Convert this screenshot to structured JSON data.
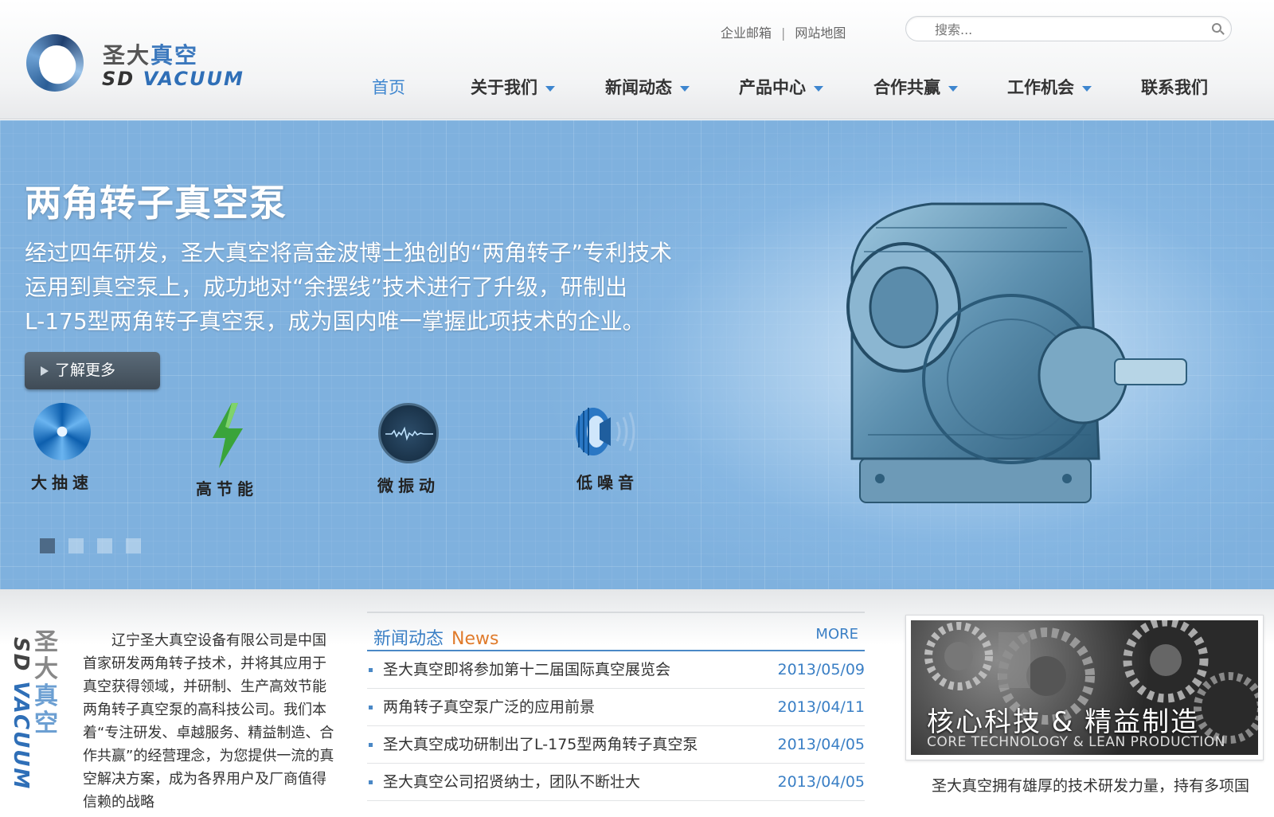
{
  "header": {
    "logo": {
      "cn_plain": "圣大",
      "cn_highlight": "真空",
      "en_plain": "SD",
      "en_highlight": "VACUUM"
    },
    "top_links": [
      "企业邮箱",
      "网站地图"
    ],
    "search": {
      "placeholder": "搜索..."
    },
    "nav": [
      {
        "label": "首页",
        "active": true,
        "dropdown": false
      },
      {
        "label": "关于我们",
        "dropdown": true
      },
      {
        "label": "新闻动态",
        "dropdown": true
      },
      {
        "label": "产品中心",
        "dropdown": true
      },
      {
        "label": "合作共赢",
        "dropdown": true
      },
      {
        "label": "工作机会",
        "dropdown": true
      },
      {
        "label": "联系我们",
        "dropdown": false
      }
    ]
  },
  "banner": {
    "title": "两角转子真空泵",
    "lines": [
      "经过四年研发，圣大真空将高金波博士独创的“两角转子”专利技术",
      "运用到真空泵上，成功地对“余摆线”技术进行了升级，研制出",
      "L-175型两角转子真空泵，成为国内唯一掌握此项技术的企业。"
    ],
    "button": "了解更多",
    "features": [
      "大抽速",
      "高节能",
      "微振动",
      "低噪音"
    ],
    "slide_count": 4,
    "active_slide": 1
  },
  "intro": {
    "text": "辽宁圣大真空设备有限公司是中国首家研发两角转子技术，并将其应用于真空获得领域，并研制、生产高效节能两角转子真空泵的高科技公司。我们本着“专注研发、卓越服务、精益制造、合作共赢”的经营理念，为您提供一流的真空解决方案，成为各界用户及厂商值得信赖的战略"
  },
  "news": {
    "title_cn": "新闻动态",
    "title_en": "News",
    "more": "MORE",
    "items": [
      {
        "title": "圣大真空即将参加第十二届国际真空展览会",
        "date": "2013/05/09"
      },
      {
        "title": "两角转子真空泵广泛的应用前景",
        "date": "2013/04/11"
      },
      {
        "title": "圣大真空成功研制出了L-175型两角转子真空泵",
        "date": "2013/04/05"
      },
      {
        "title": "圣大真空公司招贤纳士，团队不断壮大",
        "date": "2013/04/05"
      }
    ]
  },
  "core": {
    "title_cn": "核心科技 & 精益制造",
    "title_en": "CORE TECHNOLOGY & LEAN PRODUCTION",
    "text": "圣大真空拥有雄厚的技术研发力量，持有多项国"
  },
  "colors": {
    "accent": "#3e86cf",
    "banner": "#7fb1de",
    "news_en": "#e07b2c"
  }
}
